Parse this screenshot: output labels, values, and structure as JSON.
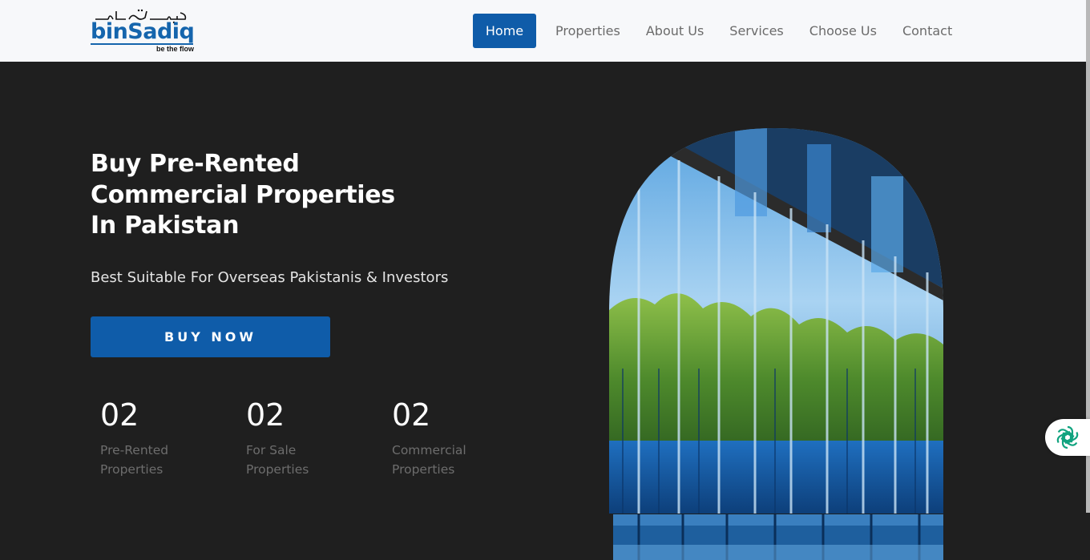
{
  "logo": {
    "brand": "binSadiq",
    "urdu": "بن صادق",
    "tagline": "be the flow",
    "color": "#1565ad"
  },
  "nav": {
    "items": [
      {
        "label": "Home",
        "active": true
      },
      {
        "label": "Properties",
        "active": false
      },
      {
        "label": "About Us",
        "active": false
      },
      {
        "label": "Services",
        "active": false
      },
      {
        "label": "Choose Us",
        "active": false
      },
      {
        "label": "Contact",
        "active": false
      }
    ],
    "active_color": "#0f5ca9"
  },
  "hero": {
    "title_lines": [
      "Buy Pre-Rented",
      "Commercial Properties",
      "In Pakistan"
    ],
    "subtitle": "Best Suitable For Overseas Pakistanis & Investors",
    "cta_label": "BUY NOW"
  },
  "stats": [
    {
      "value": "02",
      "label_lines": [
        "Pre-Rented",
        "Properties"
      ]
    },
    {
      "value": "02",
      "label_lines": [
        "For Sale",
        "Properties"
      ]
    },
    {
      "value": "02",
      "label_lines": [
        "Commercial",
        "Properties"
      ]
    }
  ],
  "widget": {
    "icon": "ai-assistant-icon",
    "color": "#10a37f"
  },
  "colors": {
    "background": "#1f1f1f",
    "header": "#f7f8fa",
    "primary": "#0f5ca9"
  }
}
